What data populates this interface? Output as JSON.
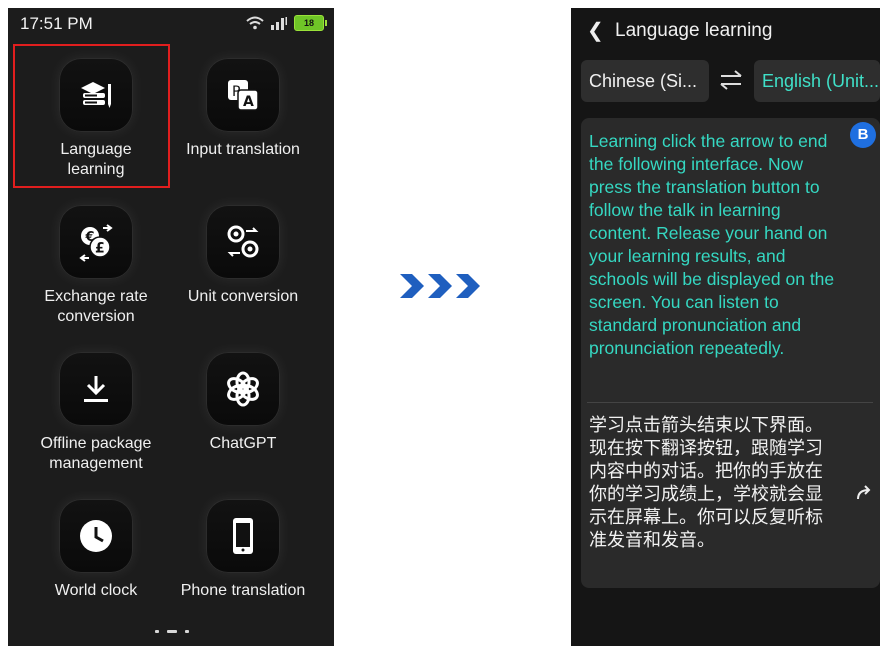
{
  "left": {
    "status": {
      "time": "17:51 PM",
      "battery": "18"
    },
    "tiles": [
      {
        "label": "Language learning",
        "icon": "language-learning-icon"
      },
      {
        "label": "Input translation",
        "icon": "input-translation-icon"
      },
      {
        "label": "Exchange rate conversion",
        "icon": "exchange-rate-icon"
      },
      {
        "label": "Unit conversion",
        "icon": "unit-conversion-icon"
      },
      {
        "label": "Offline package management",
        "icon": "download-icon"
      },
      {
        "label": "ChatGPT",
        "icon": "chatgpt-icon"
      },
      {
        "label": "World clock",
        "icon": "clock-icon"
      },
      {
        "label": "Phone translation",
        "icon": "phone-icon"
      }
    ]
  },
  "right": {
    "title": "Language learning",
    "source_lang": "Chinese (Si...",
    "target_lang": "English (Unit...",
    "avatar": "B",
    "source_text": " Learning click the arrow to end the following interface. Now press the translation button to follow the talk in learning content. Release your hand on your learning results, and schools will be displayed on the screen. You can listen to standard pronunciation and pronunciation repeatedly.",
    "translated_text": "学习点击箭头结束以下界面。现在按下翻译按钮，跟随学习内容中的对话。把你的手放在你的学习成绩上，学校就会显示在屏幕上。你可以反复听标准发音和发音。"
  },
  "colors": {
    "accent": "#35d8c2",
    "arrow": "#1f5fbf",
    "highlight": "#e11e1e",
    "avatar": "#1f6fe0"
  }
}
